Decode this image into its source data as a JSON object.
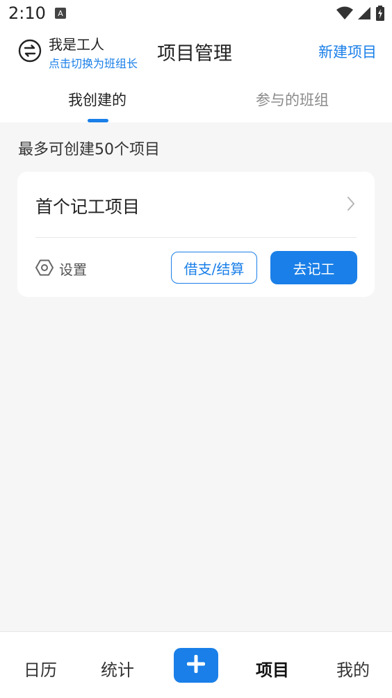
{
  "status_bar": {
    "time": "2:10",
    "icons": [
      "notification-a-icon",
      "wifi-icon",
      "signal-icon",
      "battery-charging-icon"
    ]
  },
  "header": {
    "role_title": "我是工人",
    "role_switch_hint": "点击切换为班组长",
    "page_title": "项目管理",
    "new_project_label": "新建项目"
  },
  "tabs": [
    {
      "label": "我创建的",
      "active": true
    },
    {
      "label": "参与的班组",
      "active": false
    }
  ],
  "limit_text": "最多可创建50个项目",
  "project_card": {
    "title": "首个记工项目",
    "settings_label": "设置",
    "loan_button_label": "借支/结算",
    "record_button_label": "去记工"
  },
  "bottom_nav": {
    "items": [
      {
        "label": "日历"
      },
      {
        "label": "统计"
      },
      {
        "label": "项目",
        "active": true
      },
      {
        "label": "我的"
      }
    ],
    "add_button_icon": "plus-icon"
  },
  "colors": {
    "accent": "#1a7fe8",
    "background": "#f6f6f6",
    "card": "#ffffff"
  }
}
